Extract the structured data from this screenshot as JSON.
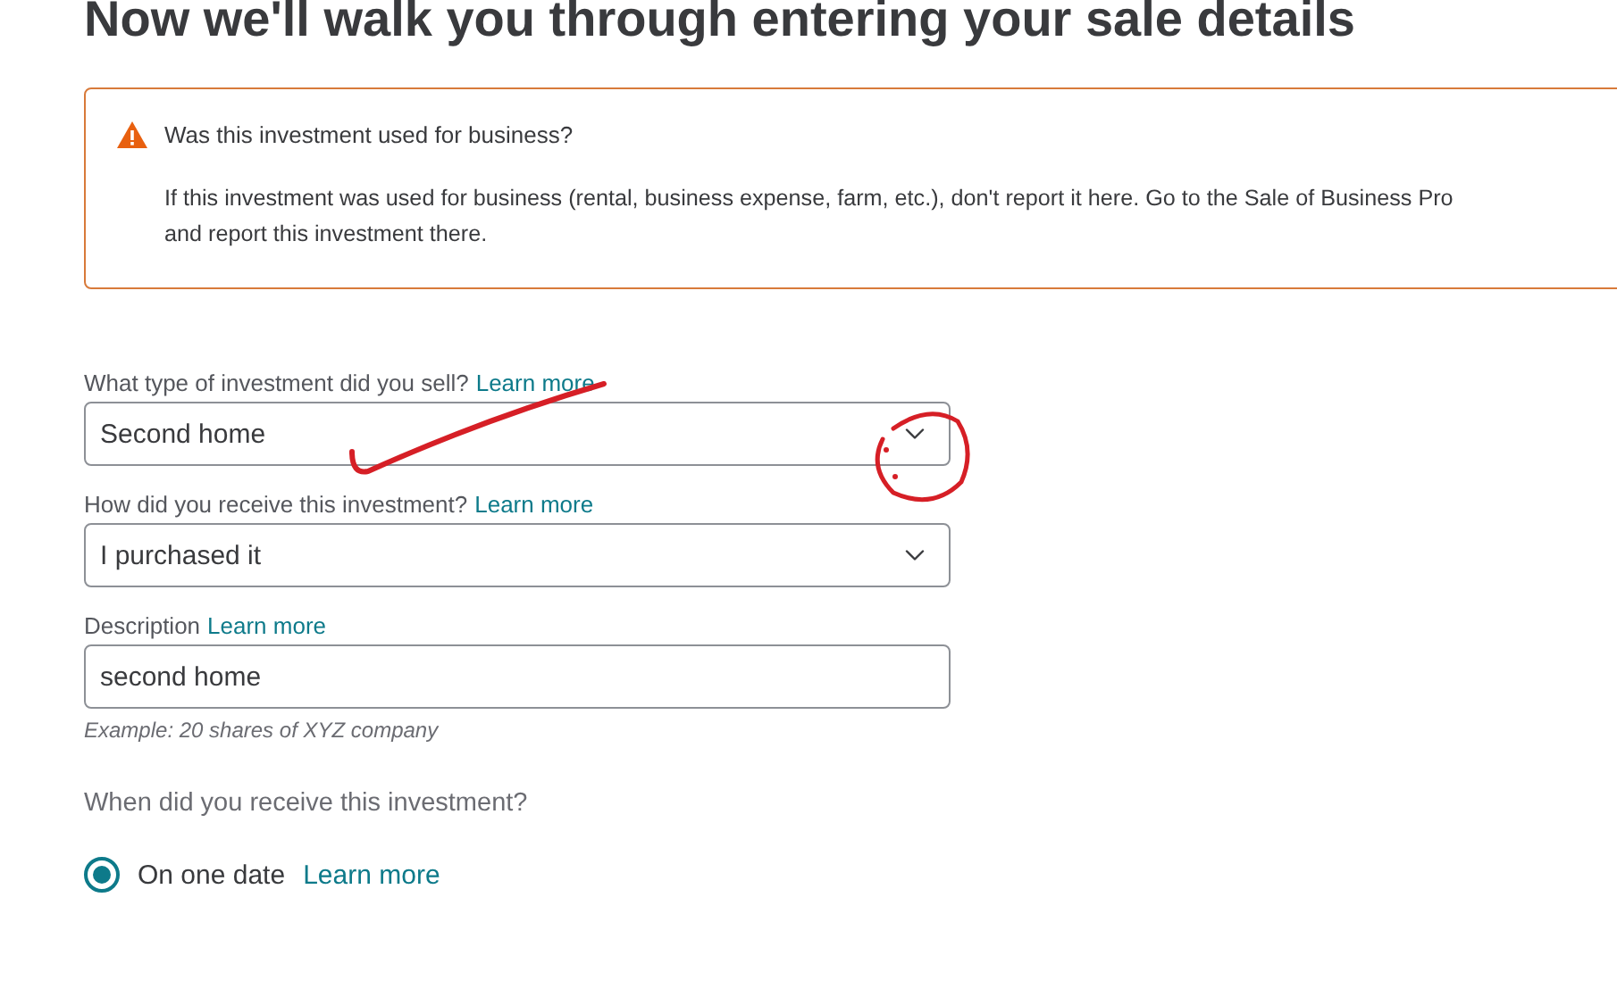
{
  "heading": "Now we'll walk you through entering your sale details",
  "alert": {
    "title": "Was this investment used for business?",
    "body_lines": [
      "If this investment was used for business (rental, business expense, farm, etc.), don't report it here. Go to the Sale of Business Pro",
      "and report this investment there."
    ]
  },
  "fields": [
    {
      "kind": "select",
      "label": "What type of investment did you sell?",
      "link": "Learn more",
      "value": "Second home"
    },
    {
      "kind": "select",
      "label": "How did you receive this investment?",
      "link": "Learn more",
      "value": "I purchased it"
    },
    {
      "kind": "text",
      "label": "Description",
      "link": "Learn more",
      "value": "second home",
      "hint": "Example: 20 shares of XYZ company"
    }
  ],
  "question": {
    "text": "When did you receive this investment?",
    "options": [
      {
        "label": "On one date",
        "link": "Learn more",
        "selected": true
      }
    ]
  }
}
